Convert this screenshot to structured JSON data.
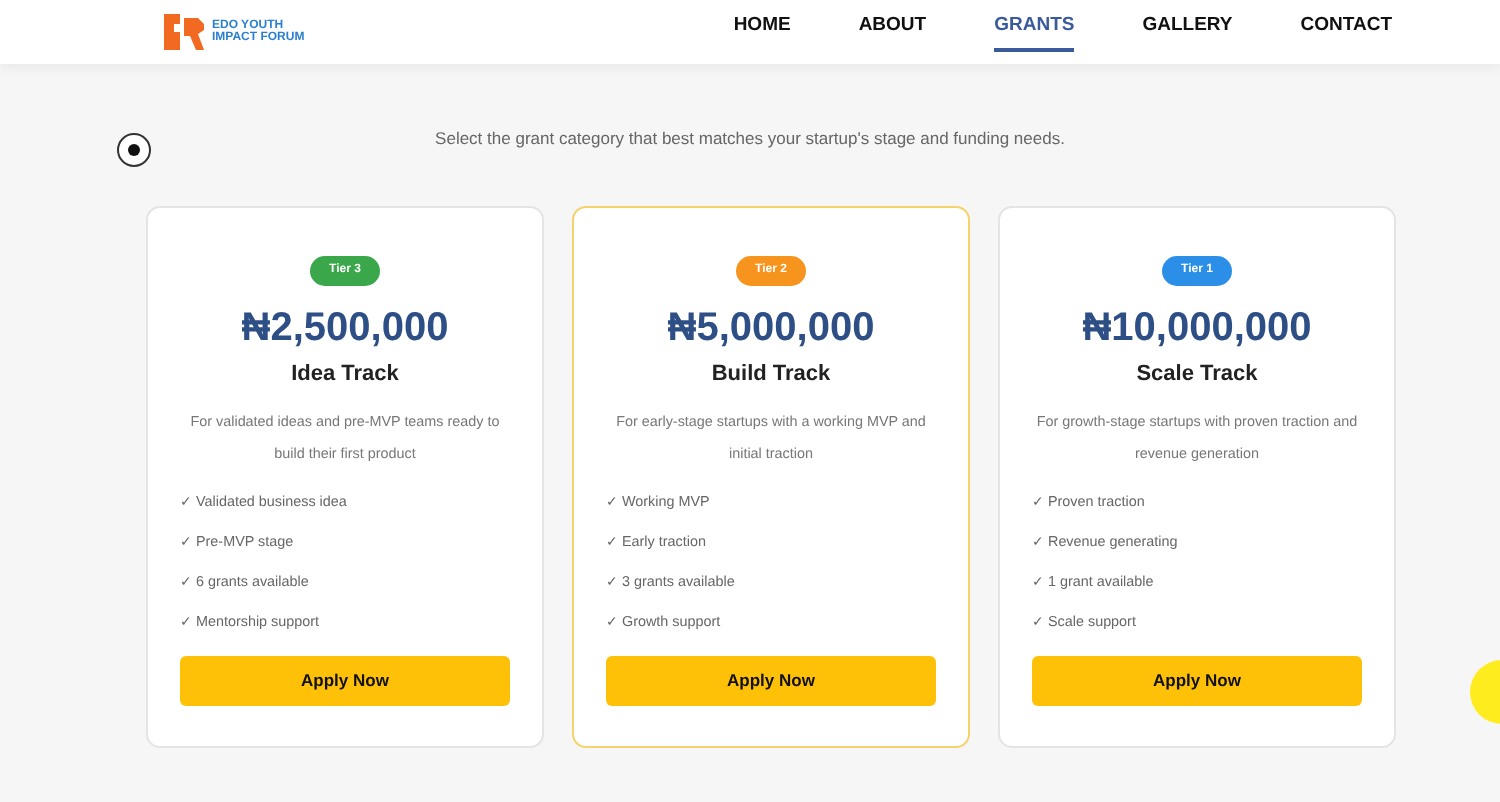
{
  "header": {
    "logo_text": [
      "EDO YOUTH",
      "IMPACT FORUM"
    ],
    "nav": [
      {
        "label": "HOME",
        "selected": false
      },
      {
        "label": "ABOUT",
        "selected": false
      },
      {
        "label": "GRANTS",
        "selected": true
      },
      {
        "label": "GALLERY",
        "selected": false
      },
      {
        "label": "CONTACT",
        "selected": false
      }
    ]
  },
  "subtitle": "Select the grant category that best matches your startup's stage and funding needs.",
  "tiers": [
    {
      "badge": "Tier 3",
      "color": "#3aa84a",
      "amount": "₦2,500,000",
      "name": "Idea Track",
      "featured": false,
      "description": "For validated ideas and pre-MVP teams ready to build their first product",
      "features": [
        "✓ Validated business idea",
        "✓ Pre-MVP stage",
        "✓ 6 grants available",
        "✓ Mentorship support"
      ],
      "button": "Apply Now"
    },
    {
      "badge": "Tier 2",
      "color": "#f7941d",
      "amount": "₦5,000,000",
      "name": "Build Track",
      "featured": true,
      "description": "For early-stage startups with a working MVP and initial traction",
      "features": [
        "✓ Working MVP",
        "✓ Early traction",
        "✓ 3 grants available",
        "✓ Growth support"
      ],
      "button": "Apply Now"
    },
    {
      "badge": "Tier 1",
      "color": "#2b8fe8",
      "amount": "₦10,000,000",
      "name": "Scale Track",
      "featured": false,
      "description": "For growth-stage startups with proven traction and revenue generation",
      "features": [
        "✓ Proven traction",
        "✓ Revenue generating",
        "✓ 1 grant available",
        "✓ Scale support"
      ],
      "button": "Apply Now"
    }
  ]
}
